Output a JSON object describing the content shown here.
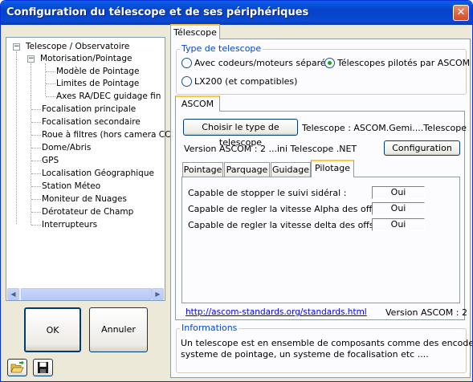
{
  "window": {
    "title": "Configuration du télescope et de ses périphériques",
    "close_glyph": "✕"
  },
  "tree": {
    "items": [
      {
        "label": "Telescope / Observatoire"
      },
      {
        "label": "Motorisation/Pointage"
      },
      {
        "label": "Modèle de Pointage"
      },
      {
        "label": "Limites de Pointage"
      },
      {
        "label": "Axes RA/DEC guidage fin"
      },
      {
        "label": "Focalisation principale"
      },
      {
        "label": "Focalisation secondaire"
      },
      {
        "label": "Roue à filtres (hors camera CCD)"
      },
      {
        "label": "Dome/Abris"
      },
      {
        "label": "GPS"
      },
      {
        "label": "Localisation Géographique"
      },
      {
        "label": "Station Méteo"
      },
      {
        "label": "Moniteur de Nuages"
      },
      {
        "label": "Dérotateur de Champ"
      },
      {
        "label": "Interrupteurs"
      }
    ],
    "expand_symbol": "−"
  },
  "buttons": {
    "ok": "OK",
    "cancel": "Annuler"
  },
  "icons": {
    "open": "folder-open-icon",
    "save": "floppy-disk-icon"
  },
  "main_tab": "Télescope",
  "type_group": {
    "label": "Type de telescope",
    "option1": "Avec codeurs/moteurs séparés",
    "option2": "Télescopes pilotés par ASCOM",
    "option3": "LX200 (et compatibles)",
    "selected": "option2"
  },
  "ascom_tab": "ASCOM",
  "ascom": {
    "choose_button": "Choisir le type de telescope",
    "telescope_text": "Telescope : ASCOM.Gemi....Telescope",
    "version_text": "Version ASCOM : 2 ...ini Telescope .NET",
    "config_button": "Configuration",
    "subtabs": [
      "Pointage",
      "Parquage",
      "Guidage",
      "Pilotage"
    ],
    "active_subtab": "Pilotage",
    "rows": [
      {
        "label": "Capable de stopper le suivi sidéral :",
        "value": "Oui"
      },
      {
        "label": "Capable de regler la vitesse Alpha des offsets :",
        "value": "Oui"
      },
      {
        "label": "Capable de regler la vitesse delta des offsets :",
        "value": "Oui"
      }
    ],
    "link": "http://ascom-standards.org/standards.html",
    "ascom_version": "Version ASCOM : 2"
  },
  "info": {
    "label": "Informations",
    "line1": "Un telescope est en ensemble de composants comme des encodeurs, un",
    "line2": "systeme de pointage, un systeme de focalisation etc ...."
  },
  "colors": {
    "title_bar": "#0a49d3",
    "group_label": "#0046d5",
    "link": "#0000ee",
    "tab_highlight": "#ffc83c"
  }
}
